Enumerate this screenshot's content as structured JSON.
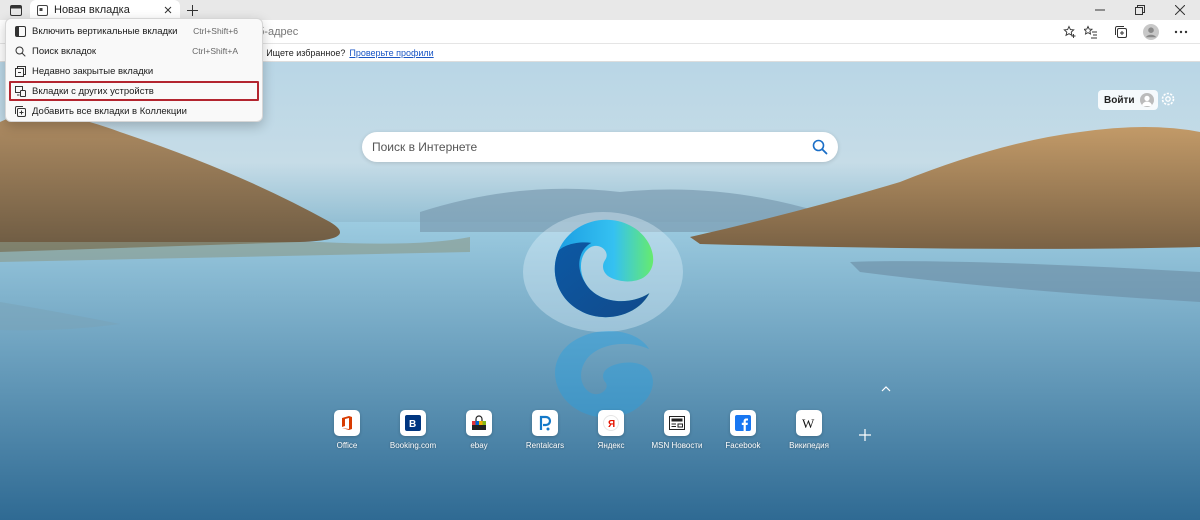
{
  "tab": {
    "title": "Новая вкладка"
  },
  "address": {
    "placeholder_visible": "б-адрес"
  },
  "favbar": {
    "message": "\". Ищете избранное?",
    "link": "Проверьте профили"
  },
  "menu": {
    "items": [
      {
        "label": "Включить вертикальные вкладки",
        "shortcut": "Ctrl+Shift+6",
        "icon": "vertical-tabs-icon"
      },
      {
        "label": "Поиск вкладок",
        "shortcut": "Ctrl+Shift+A",
        "icon": "search-icon"
      },
      {
        "label": "Недавно закрытые вкладки",
        "shortcut": "",
        "icon": "recent-tabs-icon"
      },
      {
        "label": "Вкладки с других устройств",
        "shortcut": "",
        "icon": "devices-icon"
      },
      {
        "label": "Добавить все вкладки в Коллекции",
        "shortcut": "",
        "icon": "collections-icon"
      }
    ]
  },
  "signin": {
    "label": "Войти"
  },
  "search": {
    "placeholder": "Поиск в Интернете"
  },
  "tiles": [
    {
      "label": "Office",
      "icon": "office-icon",
      "color": "#d83b01"
    },
    {
      "label": "Booking.com",
      "icon": "booking-icon",
      "color": "#003580"
    },
    {
      "label": "ebay",
      "icon": "ebay-icon",
      "color": "#e53238"
    },
    {
      "label": "Rentalcars",
      "icon": "rentalcars-icon",
      "color": "#1479c9"
    },
    {
      "label": "Яндекс",
      "icon": "yandex-icon",
      "color": "#e61400"
    },
    {
      "label": "MSN Новости",
      "icon": "msn-news-icon",
      "color": "#222222"
    },
    {
      "label": "Facebook",
      "icon": "facebook-icon",
      "color": "#1877f2"
    },
    {
      "label": "Википедия",
      "icon": "wikipedia-icon",
      "color": "#111111"
    }
  ]
}
